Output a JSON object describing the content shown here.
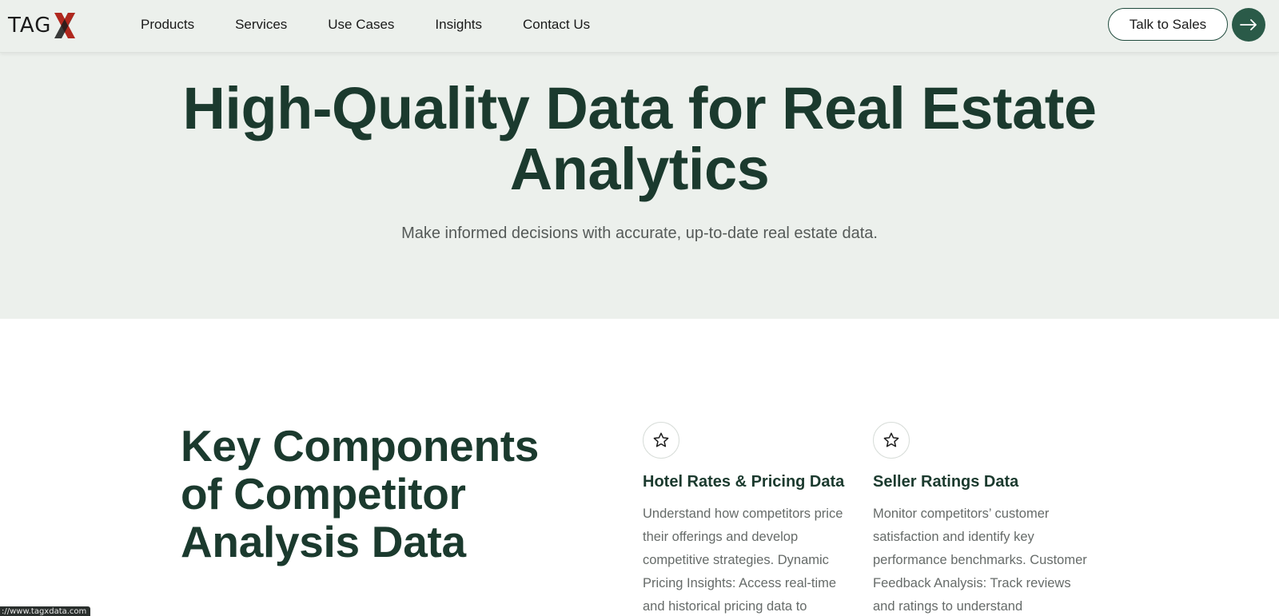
{
  "brand": {
    "logo_text": "TAG",
    "logo_x": "X",
    "accent_red": "#b0281e",
    "dark_green": "#1b3a2e",
    "button_green": "#2a5a48",
    "hero_bg": "#ecf0ec"
  },
  "nav": {
    "items": [
      {
        "label": "Products"
      },
      {
        "label": "Services"
      },
      {
        "label": "Use Cases"
      },
      {
        "label": "Insights"
      },
      {
        "label": "Contact Us"
      }
    ],
    "cta_label": "Talk to Sales",
    "cta_icon": "arrow-right-icon"
  },
  "hero": {
    "title": "High-Quality Data for Real Estate Analytics",
    "subtitle": "Make informed decisions with accurate, up-to-date real estate data."
  },
  "components": {
    "title": "Key Components of Competitor Analysis Data",
    "cards": [
      {
        "icon": "star-icon",
        "title": "Hotel Rates & Pricing Data",
        "body": "Understand how competitors price their offerings and develop competitive strategies. Dynamic Pricing Insights: Access real-time and historical pricing data to"
      },
      {
        "icon": "star-icon",
        "title": "Seller Ratings Data",
        "body": "Monitor competitors’ customer satisfaction and identify key performance benchmarks. Customer Feedback Analysis: Track reviews and ratings to understand"
      }
    ]
  },
  "status_bar": {
    "url": "://www.tagxdata.com"
  }
}
